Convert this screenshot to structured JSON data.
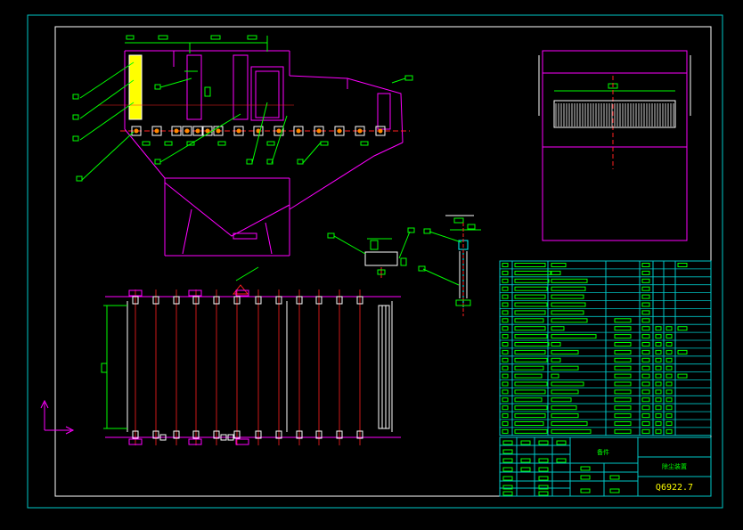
{
  "drawing": {
    "title_block_name": "除尘装置",
    "title_block_sub": "备件",
    "drawing_number": "Q6922.7"
  },
  "colors": {
    "background": "#000000",
    "border": "#00c8c8",
    "frame": "#ffffff",
    "structure": "#ff00ff",
    "dimension": "#00ff00",
    "centerline": "#ff2020",
    "component": "#ffff00",
    "table_line": "#00c8c8",
    "table_text": "#00ff00",
    "number_text": "#ffff00"
  },
  "parts_table": {
    "row_count": 22
  }
}
